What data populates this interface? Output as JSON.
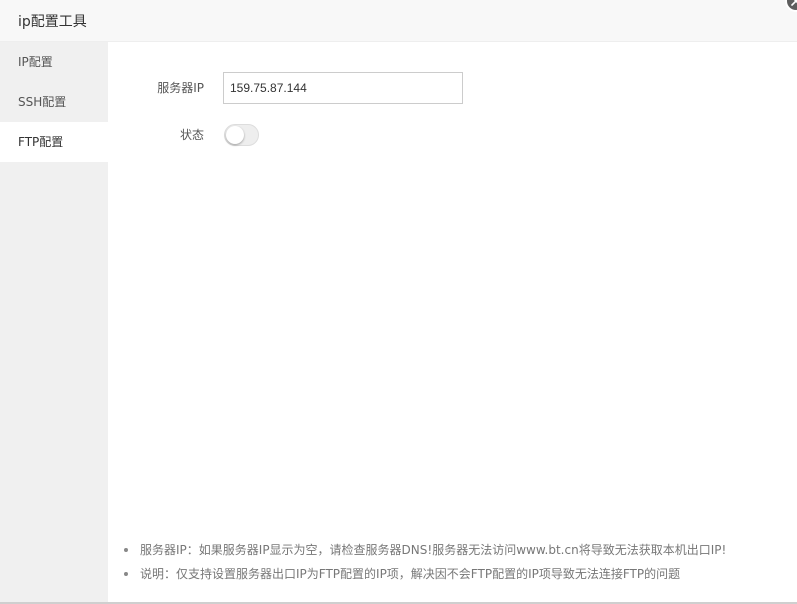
{
  "dialog": {
    "title": "ip配置工具",
    "close_icon": "close-icon"
  },
  "sidebar": {
    "items": [
      {
        "label": "IP配置",
        "active": false
      },
      {
        "label": "SSH配置",
        "active": false
      },
      {
        "label": "FTP配置",
        "active": true
      }
    ]
  },
  "form": {
    "server_ip_label": "服务器IP",
    "server_ip_value": "159.75.87.144",
    "status_label": "状态",
    "status_enabled": false
  },
  "tips": [
    "服务器IP：如果服务器IP显示为空，请检查服务器DNS!服务器无法访问www.bt.cn将导致无法获取本机出口IP!",
    "说明：仅支持设置服务器出口IP为FTP配置的IP项，解决因不会FTP配置的IP项导致无法连接FTP的问题"
  ],
  "colors": {
    "sidebar_bg": "#f0f0f0",
    "active_item_bg": "#ffffff",
    "toggle_off": "#eeeeee"
  }
}
